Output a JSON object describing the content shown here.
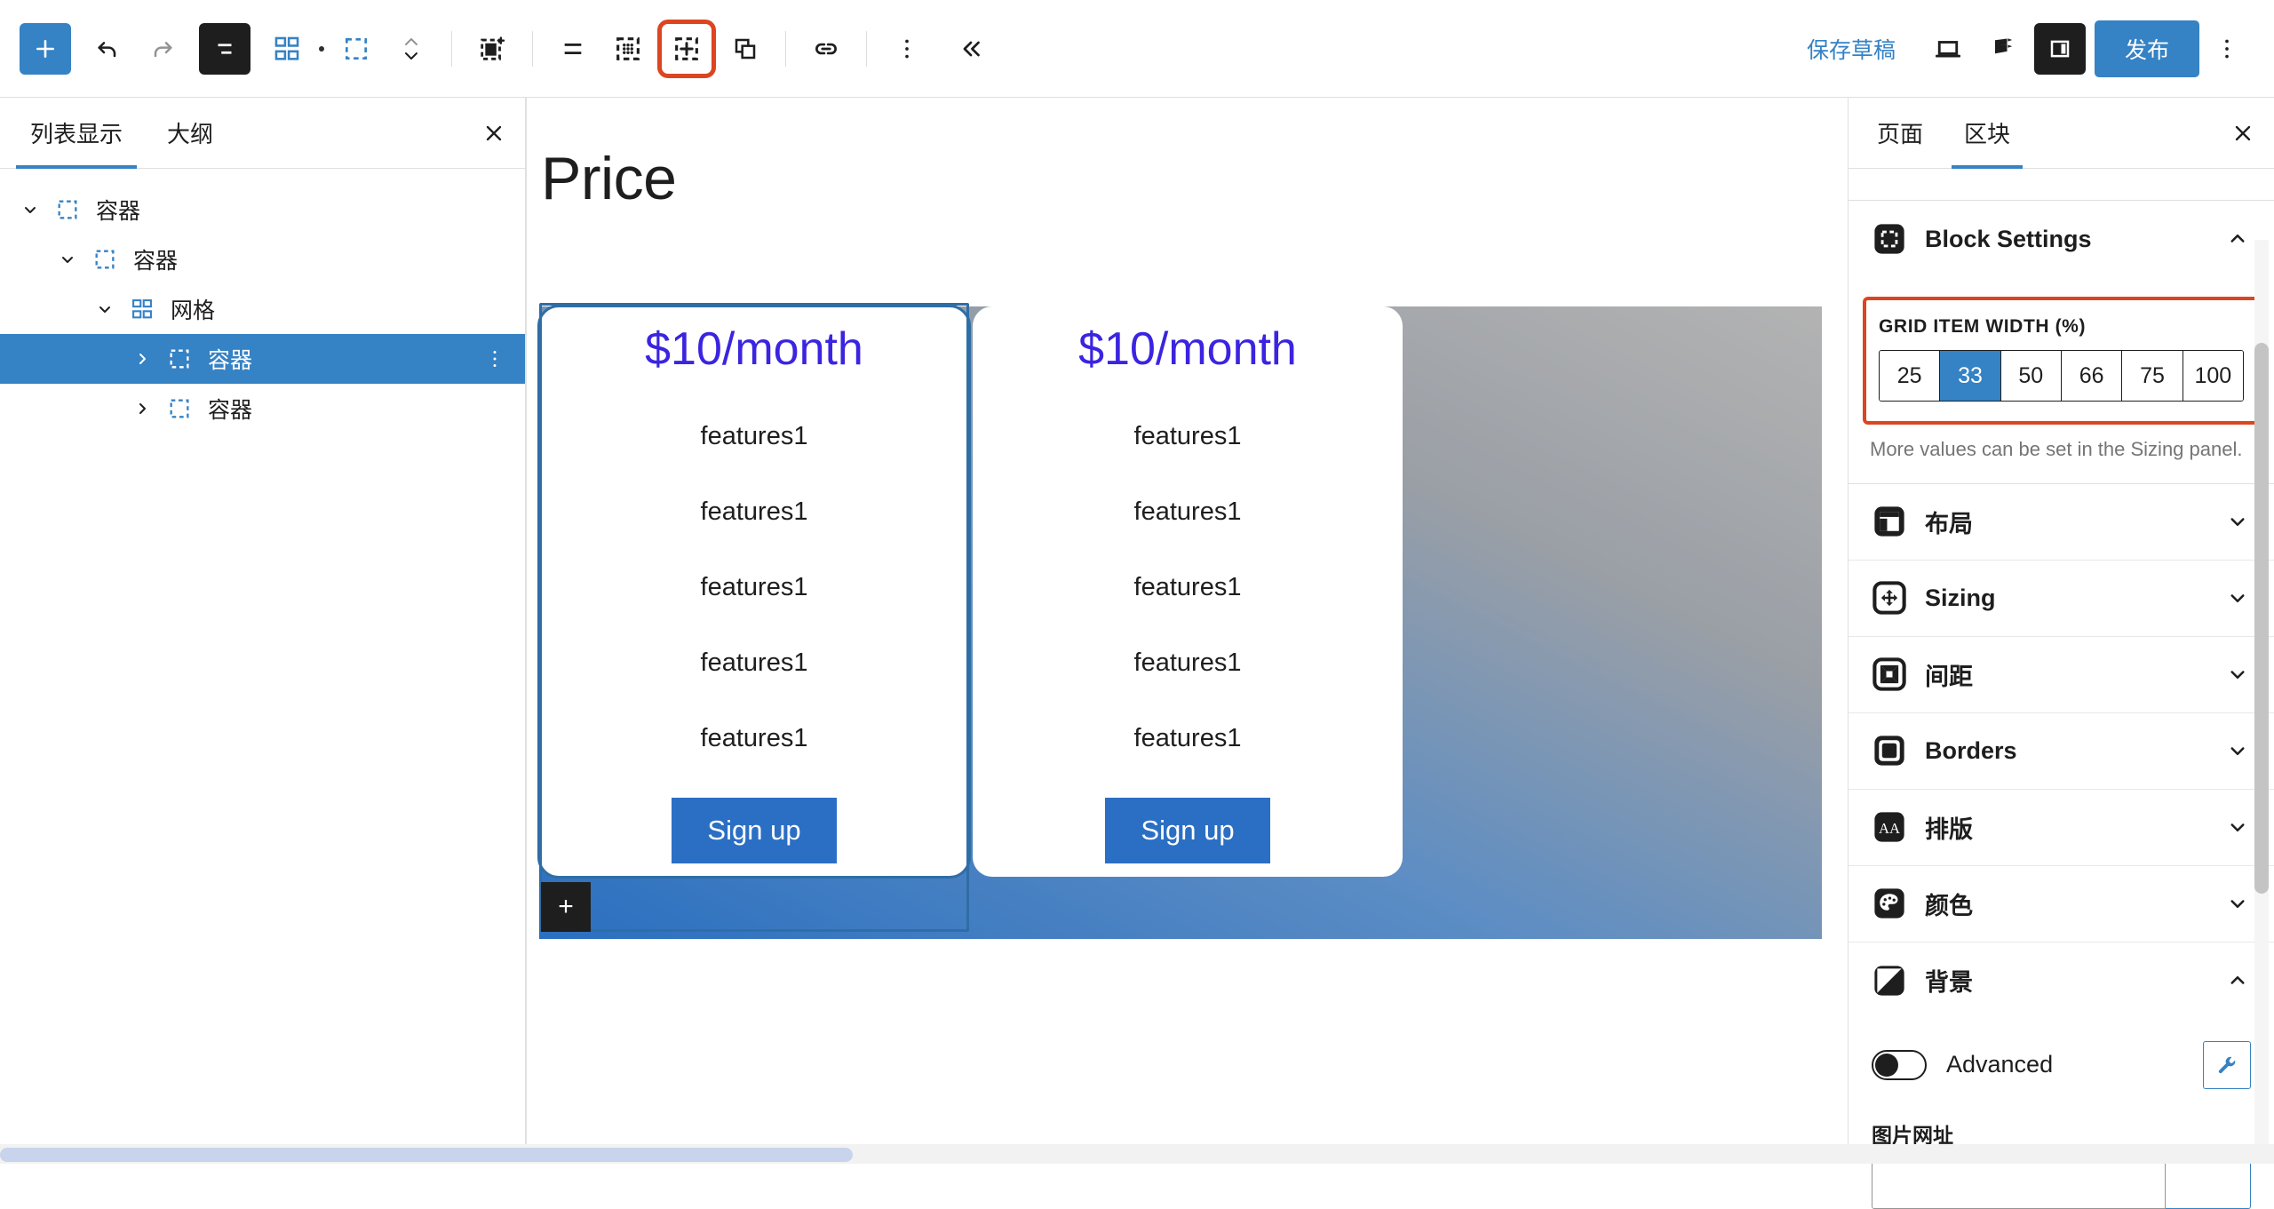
{
  "toolbar": {
    "add_block_label": "+",
    "items": [
      {
        "name": "add-block-button",
        "icon": "plus-icon",
        "label": "添加区块"
      },
      {
        "name": "undo-button",
        "icon": "undo-arrow-icon",
        "label": "撤销"
      },
      {
        "name": "redo-button",
        "icon": "redo-arrow-icon",
        "label": "重做"
      },
      {
        "name": "document-overview-button",
        "icon": "document-lines-icon",
        "label": "文档概览"
      },
      {
        "name": "grid-blocks-button",
        "icon": "grid-blocks-icon",
        "label": "网格"
      },
      {
        "name": "select-parent-button",
        "icon": "dashed-square-icon",
        "label": "选择上级"
      },
      {
        "name": "move-updown-button",
        "icon": "chevron-updown-icon",
        "label": "上移下移"
      },
      {
        "name": "select-block-button",
        "icon": "filled-dashed-square-plus-icon",
        "label": "选择区块"
      },
      {
        "name": "align-button",
        "icon": "align-lines-icon",
        "label": "对齐"
      },
      {
        "name": "grid-dots-button",
        "icon": "dotted-grid-icon",
        "label": "网格点"
      },
      {
        "name": "add-grid-item-button",
        "icon": "dashed-square-plus-icon",
        "label": "添加网格项"
      },
      {
        "name": "duplicate-button",
        "icon": "copy-icon",
        "label": "复制"
      },
      {
        "name": "link-button",
        "icon": "link-icon",
        "label": "链接"
      },
      {
        "name": "more-options-button",
        "icon": "vertical-dots-icon",
        "label": "更多选项"
      },
      {
        "name": "collapse-toolbar-button",
        "icon": "double-chevron-left-icon",
        "label": "收起"
      }
    ],
    "save_draft_label": "保存草稿",
    "preview_label": "preview-icon",
    "view_label": "view-icon",
    "sidebar_toggle_label": "sidebar-toggle-icon",
    "publish_label": "发布",
    "more_label": "vertical-dots-icon",
    "highlighted_button": "add-grid-item-button",
    "accent_color": "#3582c4",
    "highlight_color": "#dd4521"
  },
  "list_view": {
    "tabs": [
      {
        "label": "列表显示",
        "active": true
      },
      {
        "label": "大纲",
        "active": false
      }
    ],
    "close_label": "×",
    "tree": [
      {
        "label": "容器",
        "depth": 0,
        "icon": "dashed-square-icon",
        "expanded": true,
        "selected": false
      },
      {
        "label": "容器",
        "depth": 1,
        "icon": "dashed-square-icon",
        "expanded": true,
        "selected": false
      },
      {
        "label": "网格",
        "depth": 2,
        "icon": "grid-blocks-icon",
        "expanded": true,
        "selected": false
      },
      {
        "label": "容器",
        "depth": 3,
        "icon": "dashed-square-icon",
        "expanded": false,
        "selected": true
      },
      {
        "label": "容器",
        "depth": 3,
        "icon": "dashed-square-icon",
        "expanded": false,
        "selected": false
      }
    ]
  },
  "canvas": {
    "page_title": "Price",
    "appender_label": "+",
    "cards": [
      {
        "amount": "$10/month",
        "features": [
          "features1",
          "features1",
          "features1",
          "features1",
          "features1"
        ],
        "cta": "Sign up",
        "selected": true
      },
      {
        "amount": "$10/month",
        "features": [
          "features1",
          "features1",
          "features1",
          "features1",
          "features1"
        ],
        "cta": "Sign up",
        "selected": false
      }
    ],
    "amount_color": "#3b24e0",
    "cta_color": "#2b6fc4",
    "grid_background": "linear-gradient blue to gray"
  },
  "settings": {
    "tabs": [
      {
        "label": "页面",
        "active": false
      },
      {
        "label": "区块",
        "active": true
      }
    ],
    "close_label": "×",
    "block_settings": {
      "title": "Block Settings",
      "icon": "dashed-square-icon",
      "expanded": true,
      "grid_item_width": {
        "label": "GRID ITEM WIDTH (%)",
        "options": [
          "25",
          "33",
          "50",
          "66",
          "75",
          "100"
        ],
        "selected": "33",
        "help": "More values can be set in the Sizing panel."
      }
    },
    "panels": [
      {
        "label": "布局",
        "icon": "layout-icon",
        "expanded": false
      },
      {
        "label": "Sizing",
        "icon": "resize-arrows-icon",
        "expanded": false
      },
      {
        "label": "间距",
        "icon": "spacing-icon",
        "expanded": false
      },
      {
        "label": "Borders",
        "icon": "border-square-icon",
        "expanded": false
      },
      {
        "label": "排版",
        "icon": "typography-aa-icon",
        "expanded": false
      },
      {
        "label": "颜色",
        "icon": "color-palette-icon",
        "expanded": false
      },
      {
        "label": "背景",
        "icon": "background-contrast-icon",
        "expanded": true
      }
    ],
    "background": {
      "advanced_label": "Advanced",
      "advanced_on": false,
      "wrench_icon": "wrench-icon",
      "image_url_label": "图片网址",
      "image_url_value": "",
      "image_url_placeholder": ""
    }
  }
}
